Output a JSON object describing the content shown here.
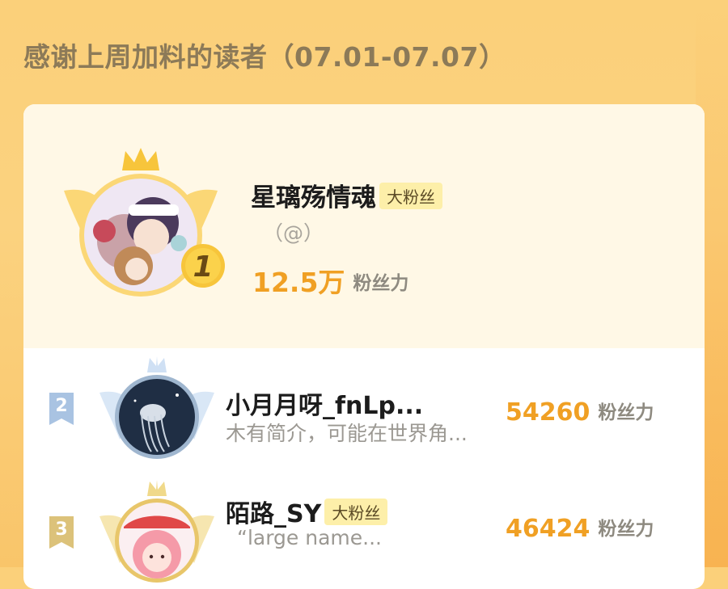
{
  "page": {
    "title": "感谢上周加料的读者（07.01-07.07）"
  },
  "top_reader": {
    "rank": "1",
    "name": "星璃殇情魂",
    "badge": "大粉丝",
    "handle": "（@）",
    "score": "12.5万",
    "score_unit": "粉丝力"
  },
  "readers": [
    {
      "rank": "2",
      "name": "小月月呀_fnLp...",
      "desc": "木有简介，可能在世界角...",
      "score": "54260",
      "score_unit": "粉丝力"
    },
    {
      "rank": "3",
      "name": "陌路_SY",
      "badge": "大粉丝",
      "desc": "“large name...",
      "score": "46424",
      "score_unit": "粉丝力"
    }
  ],
  "colors": {
    "accent": "#f0a024",
    "badge_bg": "#fdefa9",
    "title": "#8c7a58",
    "rank2": "#a9c3e2",
    "rank3": "#dcc27a"
  },
  "icons": {
    "crown": "crown-icon",
    "wings": "wings-icon",
    "rank_medal": "medal-icon"
  }
}
